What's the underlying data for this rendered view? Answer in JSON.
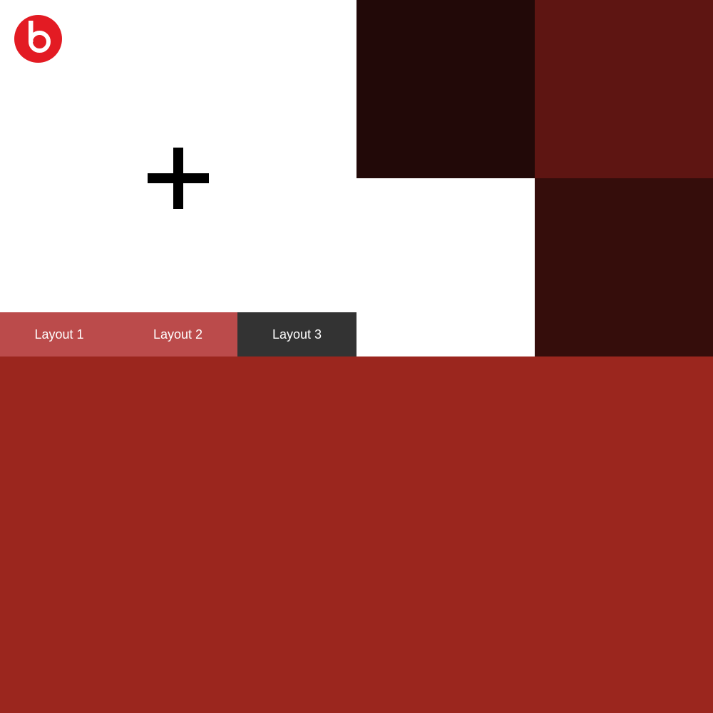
{
  "brand": {
    "logo_icon": "beats-logo-icon",
    "logo_color": "#e31b23"
  },
  "canvas": {
    "add_icon": "plus-icon",
    "add_icon_color": "#000000"
  },
  "layout_tabs": [
    {
      "label": "Layout 1",
      "color": "#bb4b4b",
      "active": false
    },
    {
      "label": "Layout 2",
      "color": "#bb4b4b",
      "active": false
    },
    {
      "label": "Layout 3",
      "color": "#333333",
      "active": true
    }
  ],
  "tiles": [
    {
      "name": "color-tile-dark-maroon",
      "color": "#220908"
    },
    {
      "name": "color-tile-burgundy",
      "color": "#5e1512"
    },
    {
      "name": "color-tile-white",
      "color": "#ffffff"
    },
    {
      "name": "color-tile-deep-maroon",
      "color": "#350d0b"
    },
    {
      "name": "color-tile-red",
      "color": "#9b261e"
    }
  ]
}
